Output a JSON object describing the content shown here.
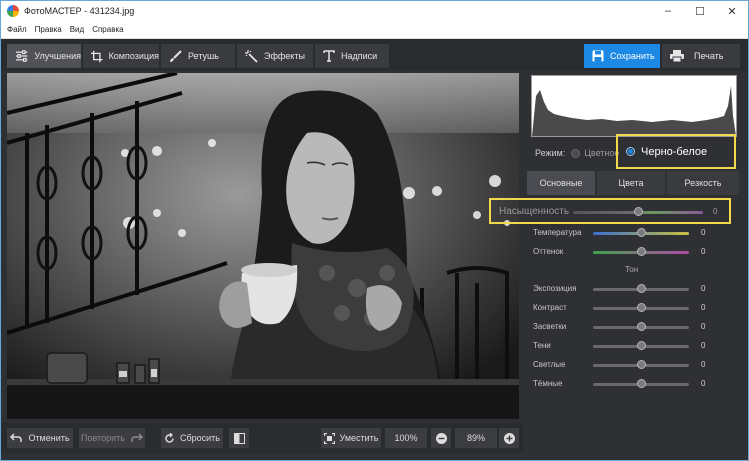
{
  "window": {
    "title": "ФотоМАСТЕР - 431234.jpg"
  },
  "menu": [
    "Файл",
    "Правка",
    "Вид",
    "Справка"
  ],
  "tabs": [
    "Улучшения",
    "Композиция",
    "Ретушь",
    "Эффекты",
    "Надписи"
  ],
  "toolbar": {
    "save_label": "Сохранить",
    "print_label": "Печать"
  },
  "bottombar": {
    "undo_label": "Отменить",
    "redo_label": "Повторить",
    "reset_label": "Сбросить",
    "fit_label": "Уместить",
    "zoom_100": "100%",
    "zoom_value": "89%"
  },
  "panel": {
    "mode_label": "Режим:",
    "mode_color": "Цветное",
    "mode_bw": "Черно-белое",
    "tabs": [
      "Основные",
      "Цвета",
      "Резкость"
    ],
    "saturation": {
      "label": "Насыщенность",
      "value": "0",
      "level": 0.5
    },
    "color_sliders": [
      {
        "label": "Температура",
        "value": "0",
        "level": 0.5
      },
      {
        "label": "Оттенок",
        "value": "0",
        "level": 0.5
      }
    ],
    "tone_label": "Тон",
    "tone_sliders": [
      {
        "label": "Экспозиция",
        "value": "0",
        "level": 0.5
      },
      {
        "label": "Контраст",
        "value": "0",
        "level": 0.5
      },
      {
        "label": "Засветки",
        "value": "0",
        "level": 0.5
      },
      {
        "label": "Тени",
        "value": "0",
        "level": 0.5
      },
      {
        "label": "Светлые",
        "value": "0",
        "level": 0.5
      },
      {
        "label": "Тёмные",
        "value": "0",
        "level": 0.5
      }
    ]
  },
  "colors": {
    "accent": "#1e88e5",
    "highlight": "#f0d94a",
    "background": "#2f3033"
  }
}
